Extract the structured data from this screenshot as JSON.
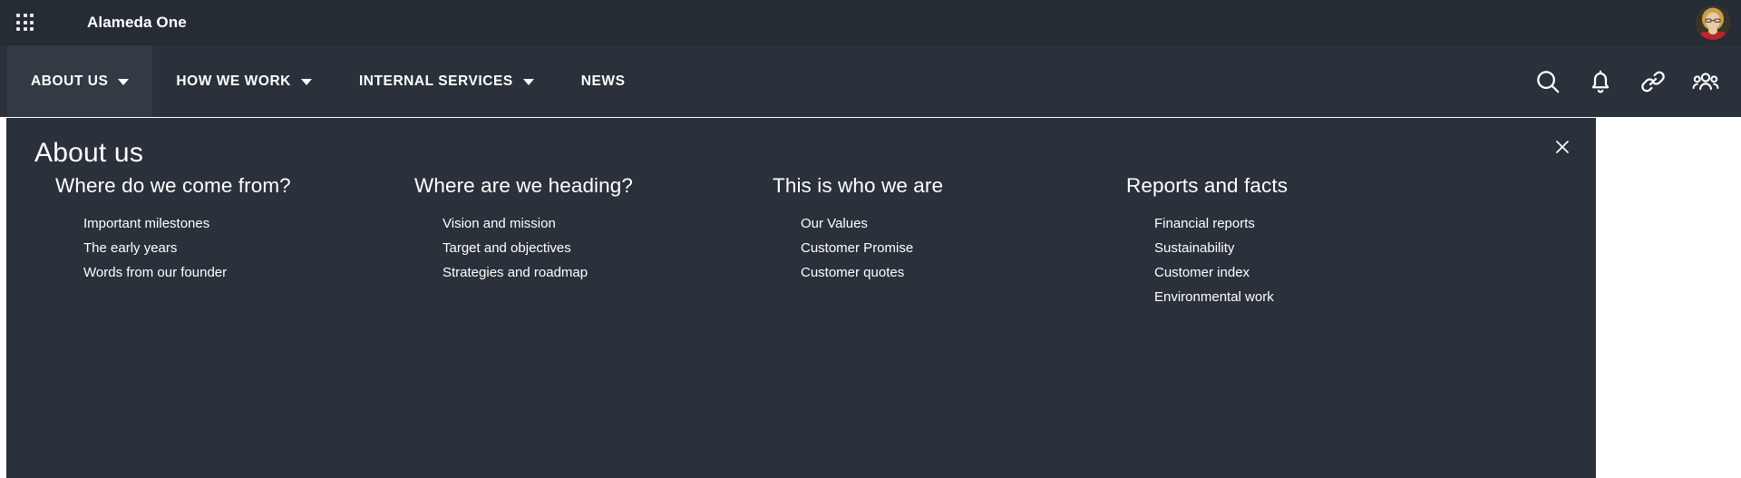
{
  "topbar": {
    "apps_icon": "grid-apps-icon",
    "brand": "Alameda One",
    "avatar_icon": "user-avatar"
  },
  "nav": {
    "items": [
      {
        "label": "ABOUT US",
        "has_caret": true,
        "active": true
      },
      {
        "label": "HOW WE WORK",
        "has_caret": true,
        "active": false
      },
      {
        "label": "INTERNAL SERVICES",
        "has_caret": true,
        "active": false
      },
      {
        "label": "NEWS",
        "has_caret": false,
        "active": false
      }
    ],
    "icons": [
      {
        "name": "search-icon"
      },
      {
        "name": "bell-icon"
      },
      {
        "name": "link-icon"
      },
      {
        "name": "people-icon"
      }
    ]
  },
  "panel": {
    "title": "About us",
    "close_label": "×",
    "columns": [
      {
        "heading": "Where do we come from?",
        "links": [
          "Important milestones",
          "The early years",
          "Words from our founder"
        ]
      },
      {
        "heading": "Where are we heading?",
        "links": [
          "Vision and mission",
          "Target and objectives",
          "Strategies and roadmap"
        ]
      },
      {
        "heading": "This is who we are",
        "links": [
          "Our Values",
          "Customer Promise",
          "Customer quotes"
        ]
      },
      {
        "heading": "Reports and facts",
        "links": [
          "Financial reports",
          "Sustainability",
          "Customer index",
          "Environmental work"
        ]
      }
    ]
  },
  "colors": {
    "topbar_bg": "#252c34",
    "nav_bg": "#2a313a",
    "nav_active_bg": "#323a44",
    "panel_bg": "#2a313a",
    "text": "#ffffff",
    "page_bg": "#ffffff"
  }
}
